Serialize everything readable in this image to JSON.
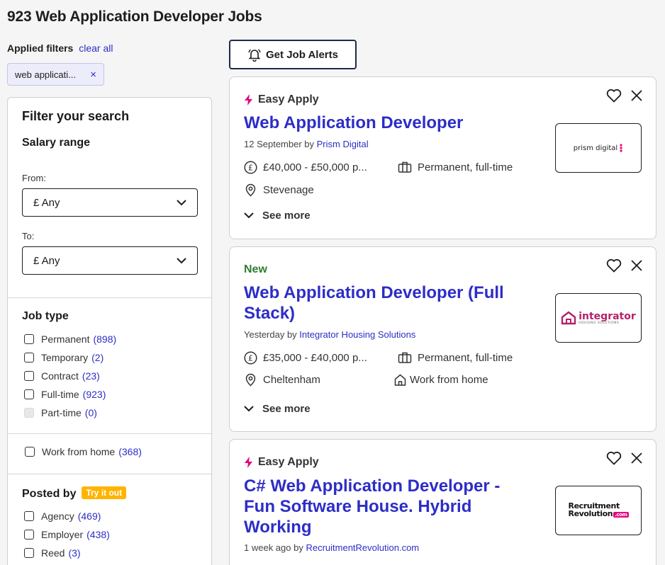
{
  "page": {
    "title": "923 Web Application Developer Jobs"
  },
  "filters": {
    "applied_label": "Applied filters",
    "clear_all": "clear all",
    "chip_text": "web applicati...",
    "chip_remove": "×"
  },
  "filter_panel": {
    "title": "Filter your search",
    "salary_heading": "Salary range",
    "from_label": "From:",
    "from_value": "£ Any",
    "to_label": "To:",
    "to_value": "£ Any",
    "job_type_heading": "Job type",
    "job_types": [
      {
        "label": "Permanent",
        "count": "(898)"
      },
      {
        "label": "Temporary",
        "count": "(2)"
      },
      {
        "label": "Contract",
        "count": "(23)"
      },
      {
        "label": "Full-time",
        "count": "(923)"
      },
      {
        "label": "Part-time",
        "count": "(0)"
      }
    ],
    "wfh": {
      "label": "Work from home",
      "count": "(368)"
    },
    "posted_by_heading": "Posted by",
    "try_it_out": "Try it out",
    "posted_by": [
      {
        "label": "Agency",
        "count": "(469)"
      },
      {
        "label": "Employer",
        "count": "(438)"
      },
      {
        "label": "Reed",
        "count": "(3)"
      }
    ]
  },
  "alerts_button": "Get Job Alerts",
  "jobs": [
    {
      "badge": "Easy Apply",
      "title": "Web Application Developer",
      "posted_prefix": "12 September by ",
      "company": "Prism Digital",
      "salary": "£40,000 - £50,000 p...",
      "type": "Permanent, full-time",
      "location": "Stevenage",
      "see_more": "See more",
      "logo_text": "prism digital"
    },
    {
      "badge": "New",
      "title": "Web Application Developer (Full Stack)",
      "posted_prefix": "Yesterday by ",
      "company": "Integrator Housing Solutions",
      "salary": "£35,000 - £40,000 p...",
      "type": "Permanent, full-time",
      "location": "Cheltenham",
      "remote": "Work from home",
      "see_more": "See more",
      "logo_text": "integrator",
      "logo_sub": "HOUSING SOLUTIONS"
    },
    {
      "badge": "Easy Apply",
      "title": "C# Web Application Developer - Fun Software House. Hybrid Working",
      "posted_prefix": "1 week ago by ",
      "company": "RecruitmentRevolution.com",
      "logo_text": "Recruitment",
      "logo_text2": "Revolution",
      "logo_suffix": ".com"
    }
  ],
  "colors": {
    "link": "#2d2dc7",
    "easy_apply_bolt": "#e6007e",
    "new_badge": "#2e7d32",
    "try_it_out": "#ffb400"
  }
}
